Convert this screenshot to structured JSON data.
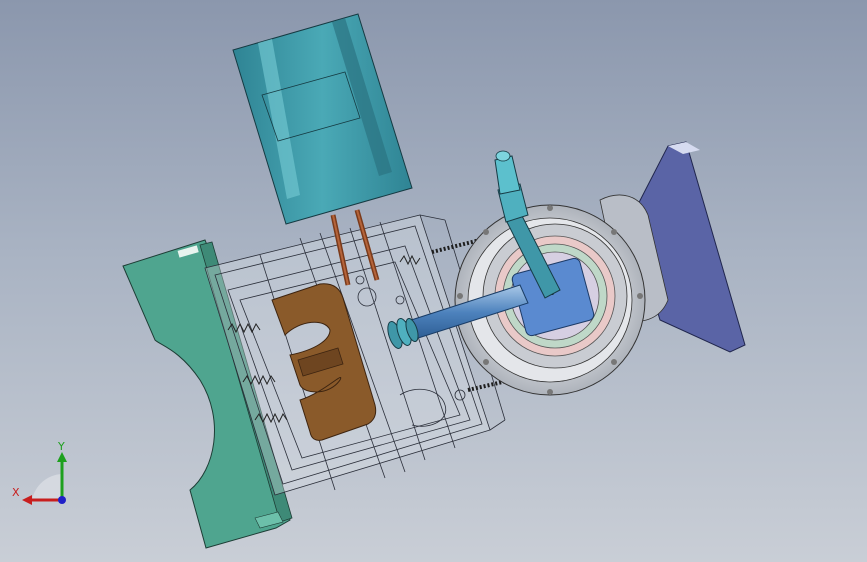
{
  "viewport": {
    "background_top": "#8b97ad",
    "background_bottom": "#c9ced6"
  },
  "colors": {
    "teal_part": "#4fa58f",
    "motor_housing": "#3f9aa8",
    "bracket_blue": "#5a64a6",
    "cam_plate_brown": "#8a5a2a",
    "wire_copper": "#a0522d",
    "bearing_gray": "#cfd3d8",
    "shaft_steel": "#5d8fc4"
  },
  "triad": {
    "x_label": "X",
    "y_label": "Y",
    "x_color": "#c81e1e",
    "y_color": "#1ea01e",
    "z_color": "#2020c8"
  },
  "icons": [
    "view-orientation-triad-icon"
  ]
}
